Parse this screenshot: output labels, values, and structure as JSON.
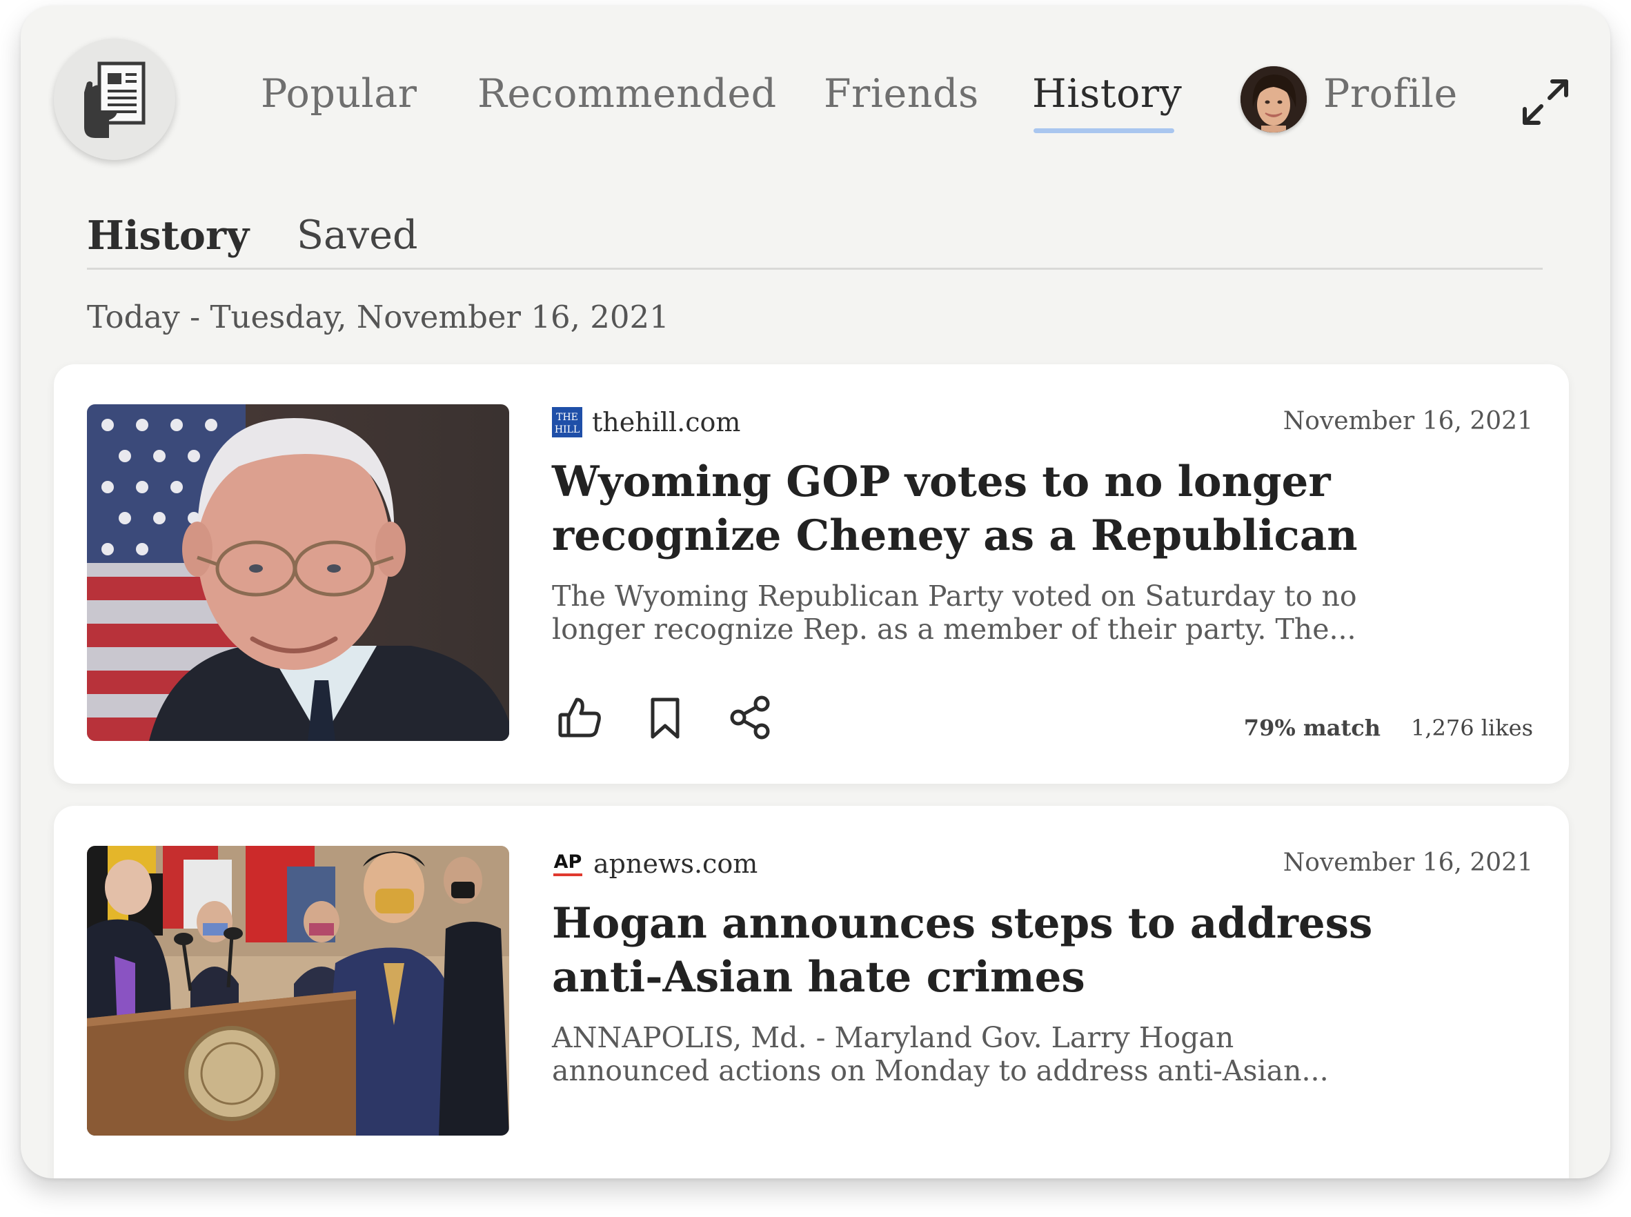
{
  "nav": {
    "items": [
      {
        "label": "Popular",
        "active": false
      },
      {
        "label": "Recommended",
        "active": false
      },
      {
        "label": "Friends",
        "active": false
      },
      {
        "label": "History",
        "active": true
      },
      {
        "label": "Profile",
        "active": false
      }
    ]
  },
  "subtabs": {
    "history": "History",
    "saved": "Saved"
  },
  "date_heading": "Today - Tuesday, November 16, 2021",
  "articles": [
    {
      "source": "thehill.com",
      "source_logo_text": "THE HILL",
      "date": "November 16, 2021",
      "headline_line1": "Wyoming GOP votes to no longer",
      "headline_line2": "recognize Cheney as a Republican",
      "snippet_line1": "The Wyoming Republican Party voted on Saturday to no",
      "snippet_line2": "longer recognize Rep. as a member of their party. The...",
      "match": "79% match",
      "likes": "1,276 likes"
    },
    {
      "source": "apnews.com",
      "source_logo_text": "AP",
      "date": "November 16, 2021",
      "headline_line1": "Hogan announces steps to address",
      "headline_line2": "anti-Asian hate crimes",
      "snippet_line1": "ANNAPOLIS, Md. - Maryland Gov. Larry Hogan",
      "snippet_line2": "announced actions on Monday to address anti-Asian..."
    }
  ],
  "colors": {
    "background": "#f4f4f2",
    "card": "#ffffff",
    "active_underline": "#a9c6ef",
    "hill_logo": "#1f4fa8",
    "ap_red": "#e03a2f"
  },
  "icons": [
    "newspaper-hand-icon",
    "expand-icon",
    "thumbs-up-icon",
    "bookmark-icon",
    "share-icon"
  ]
}
